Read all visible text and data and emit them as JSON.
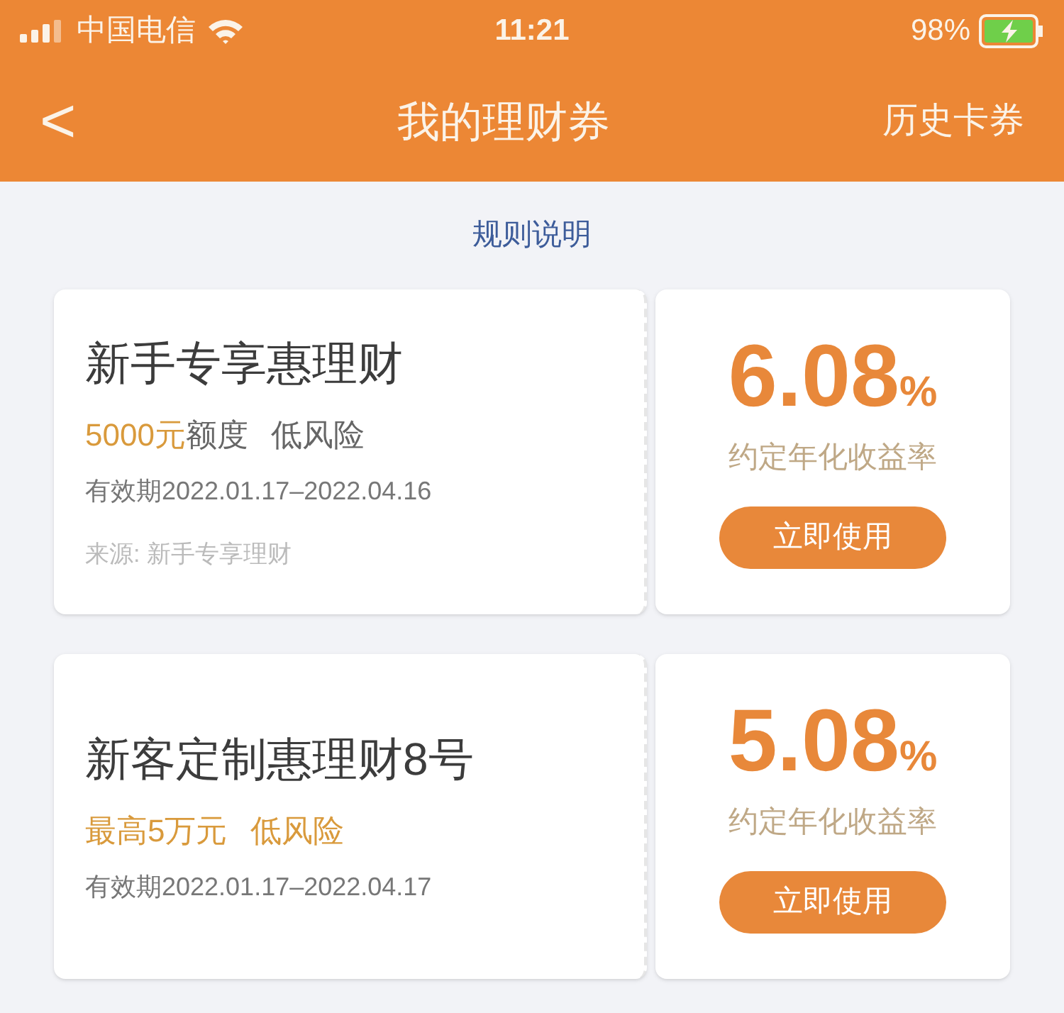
{
  "status_bar": {
    "carrier": "中国电信",
    "time": "11:21",
    "battery": "98%"
  },
  "nav": {
    "back": "<",
    "title": "我的理财券",
    "action": "历史卡券"
  },
  "rules_link": "规则说明",
  "coupons": [
    {
      "title": "新手专享惠理财",
      "tags": [
        {
          "parts": [
            {
              "text": "5000元",
              "highlight": true
            },
            {
              "text": "额度",
              "highlight": false
            }
          ]
        },
        {
          "parts": [
            {
              "text": "低风险",
              "highlight": false
            }
          ]
        }
      ],
      "validity": "有效期2022.01.17–2022.04.16",
      "source": "来源: 新手专享理财",
      "rate": "6.08",
      "unit": "%",
      "rate_label": "约定年化收益率",
      "button": "立即使用"
    },
    {
      "title": "新客定制惠理财8号",
      "tags": [
        {
          "parts": [
            {
              "text": "最高5万元",
              "highlight": true
            }
          ]
        },
        {
          "parts": [
            {
              "text": "低风险",
              "highlight": true
            }
          ]
        }
      ],
      "validity": "有效期2022.01.17–2022.04.17",
      "rate": "5.08",
      "unit": "%",
      "rate_label": "约定年化收益率",
      "button": "立即使用"
    }
  ]
}
